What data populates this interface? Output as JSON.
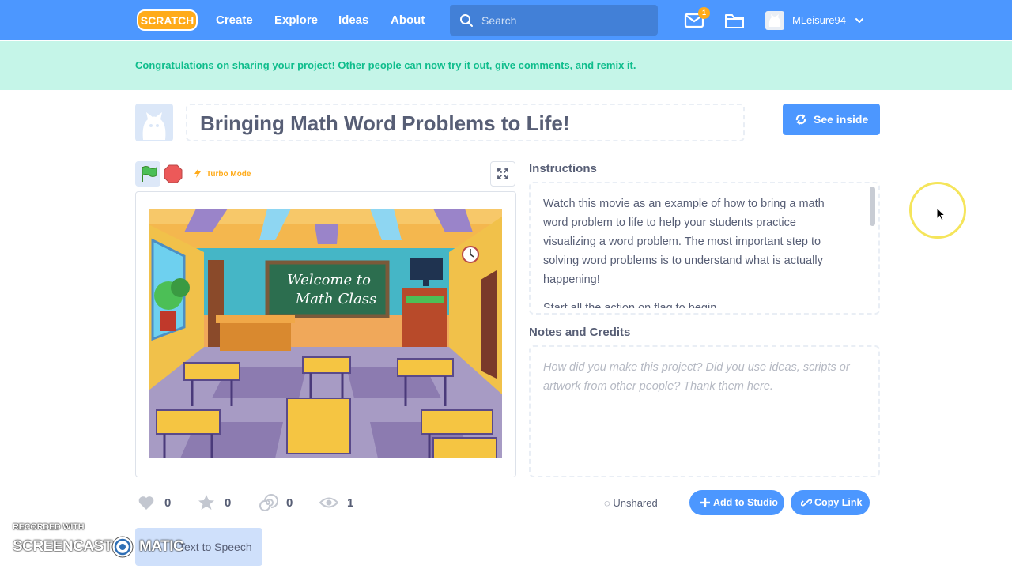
{
  "nav": {
    "logo_text": "SCRATCH",
    "links": [
      "Create",
      "Explore",
      "Ideas",
      "About"
    ],
    "search_placeholder": "Search",
    "message_count": "1",
    "username": "MLeisure94"
  },
  "banner": {
    "text": "Congratulations on sharing your project! Other people can now try it out, give comments, and remix it."
  },
  "project": {
    "title": "Bringing Math Word Problems to Life!",
    "see_inside_label": "See inside"
  },
  "player": {
    "turbo_label": "Turbo Mode",
    "stage_title_line1": "Welcome to",
    "stage_title_line2": "Math Class"
  },
  "instructions": {
    "heading": "Instructions",
    "text": "Watch this movie as an example of how to bring a math word problem to life to help your students practice visualizing a word problem. The most important step to solving word problems is to understand what is actually happening!",
    "text_more": "Start all the action on flag to begin"
  },
  "notes": {
    "heading": "Notes and Credits",
    "placeholder": "How did you make this project? Did you use ideas, scripts or artwork from other people? Thank them here."
  },
  "stats": {
    "loves": "0",
    "favorites": "0",
    "remixes": "0",
    "views": "1"
  },
  "sharing": {
    "status": "Unshared",
    "add_to_studio": "Add to Studio",
    "copy_link": "Copy Link"
  },
  "extension": {
    "tts_label": "Text to Speech"
  },
  "watermark": {
    "line1": "RECORDED WITH",
    "line2a": "SCREENCAST",
    "line2b": "MATIC"
  },
  "colors": {
    "brand_blue": "#4c97ff",
    "banner_bg": "#c5f5e8",
    "banner_text": "#0fbd8c",
    "turbo_orange": "#ffab1a"
  }
}
